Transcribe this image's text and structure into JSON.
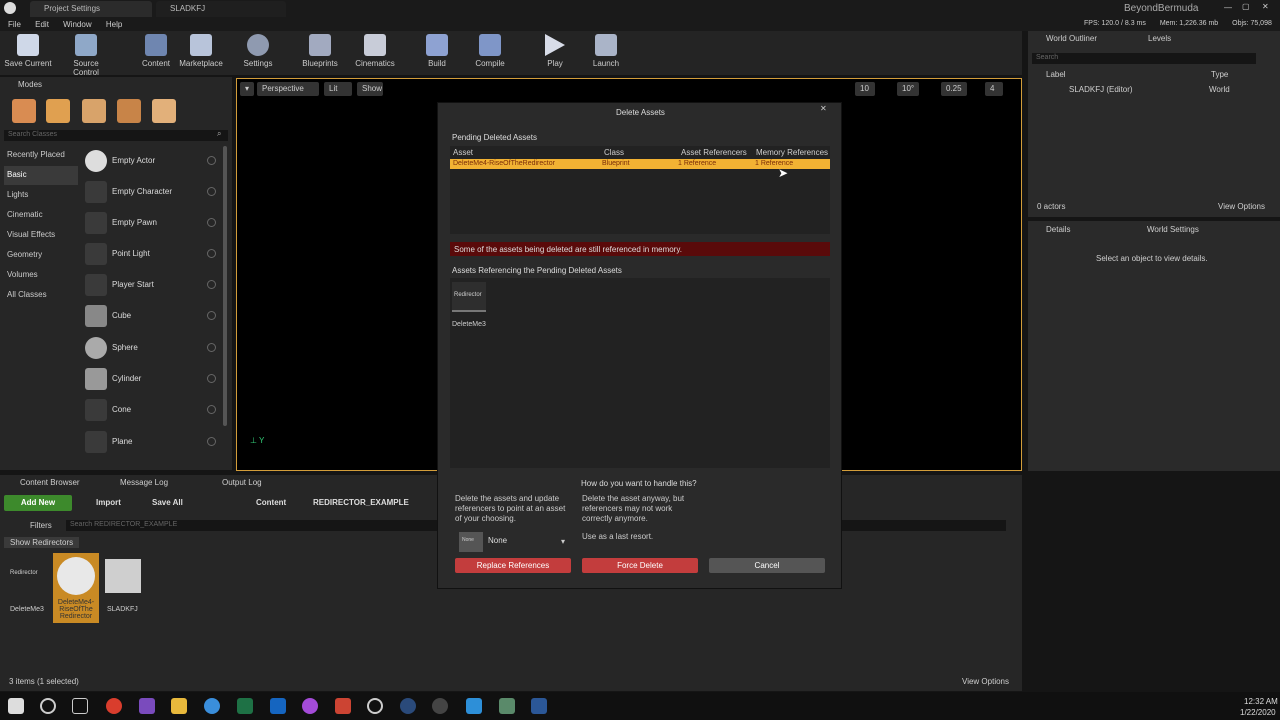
{
  "window": {
    "tab1": "Project Settings",
    "tab2": "SLADKFJ",
    "project": "BeyondBermuda",
    "stats_fps": "FPS: 120.0 / 8.3 ms",
    "stats_mem": "Mem: 1,226.36 mb",
    "stats_objs": "Objs: 75,098"
  },
  "menu": [
    "File",
    "Edit",
    "Window",
    "Help"
  ],
  "toolbar": [
    "Save Current",
    "Source Control",
    "Content",
    "Marketplace",
    "Settings",
    "Blueprints",
    "Cinematics",
    "Build",
    "Compile",
    "Play",
    "Launch"
  ],
  "modes": {
    "title": "Modes",
    "search_placeholder": "Search Classes",
    "categories": [
      "Recently Placed",
      "Basic",
      "Lights",
      "Cinematic",
      "Visual Effects",
      "Geometry",
      "Volumes",
      "All Classes"
    ],
    "items": [
      "Empty Actor",
      "Empty Character",
      "Empty Pawn",
      "Point Light",
      "Player Start",
      "Cube",
      "Sphere",
      "Cylinder",
      "Cone",
      "Plane"
    ]
  },
  "viewport": {
    "perspective": "Perspective",
    "lit": "Lit",
    "show": "Show",
    "grid": "10",
    "angle": "10°",
    "scale": "0.25",
    "cams": "4"
  },
  "outliner": {
    "tab": "World Outliner",
    "levels": "Levels",
    "search_placeholder": "Search",
    "col_label": "Label",
    "col_type": "Type",
    "row_label": "SLADKFJ (Editor)",
    "row_type": "World",
    "count": "0 actors",
    "view_options": "View Options"
  },
  "details": {
    "tab": "Details",
    "world_settings": "World Settings",
    "hint": "Select an object to view details."
  },
  "dialog": {
    "title": "Delete Assets",
    "pending": "Pending Deleted Assets",
    "headers": [
      "Asset",
      "Class",
      "Asset Referencers",
      "Memory References"
    ],
    "row": [
      "DeleteMe4-RiseOfTheRedirector",
      "Blueprint",
      "1 Reference",
      "1 Reference"
    ],
    "warning": "Some of the assets being deleted are still referenced in memory.",
    "referencing": "Assets Referencing the Pending Deleted Assets",
    "ref_thumb": "Redirector",
    "ref_name": "DeleteMe3",
    "question": "How do you want to handle this?",
    "opt1": "Delete the assets and update referencers to point at an asset of your choosing.",
    "opt2": "Delete the asset anyway, but referencers may not work correctly anymore.",
    "opt2b": "Use as a last resort.",
    "none_thumb": "None",
    "none_label": "None",
    "replace": "Replace References",
    "force": "Force Delete",
    "cancel": "Cancel"
  },
  "content": {
    "tab1": "Content Browser",
    "tab2": "Message Log",
    "tab3": "Output Log",
    "add_new": "Add New",
    "import": "Import",
    "save_all": "Save All",
    "root": "Content",
    "folder": "REDIRECTOR_EXAMPLE",
    "filters": "Filters",
    "search_placeholder": "Search REDIRECTOR_EXAMPLE",
    "show_redirectors": "Show Redirectors",
    "assets": [
      "DeleteMe3",
      "DeleteMe4-RiseOfThe Redirector",
      "SLADKFJ"
    ],
    "redirector_thumb": "Redirector",
    "count": "3 items (1 selected)",
    "view_options": "View Options"
  },
  "taskbar": {
    "time": "12:32 AM",
    "date": "1/22/2020"
  },
  "colors": {
    "accent": "#f2a82b",
    "warning": "#5a0a0a",
    "button_red": "#c33d3d",
    "selection": "#f2b233"
  }
}
